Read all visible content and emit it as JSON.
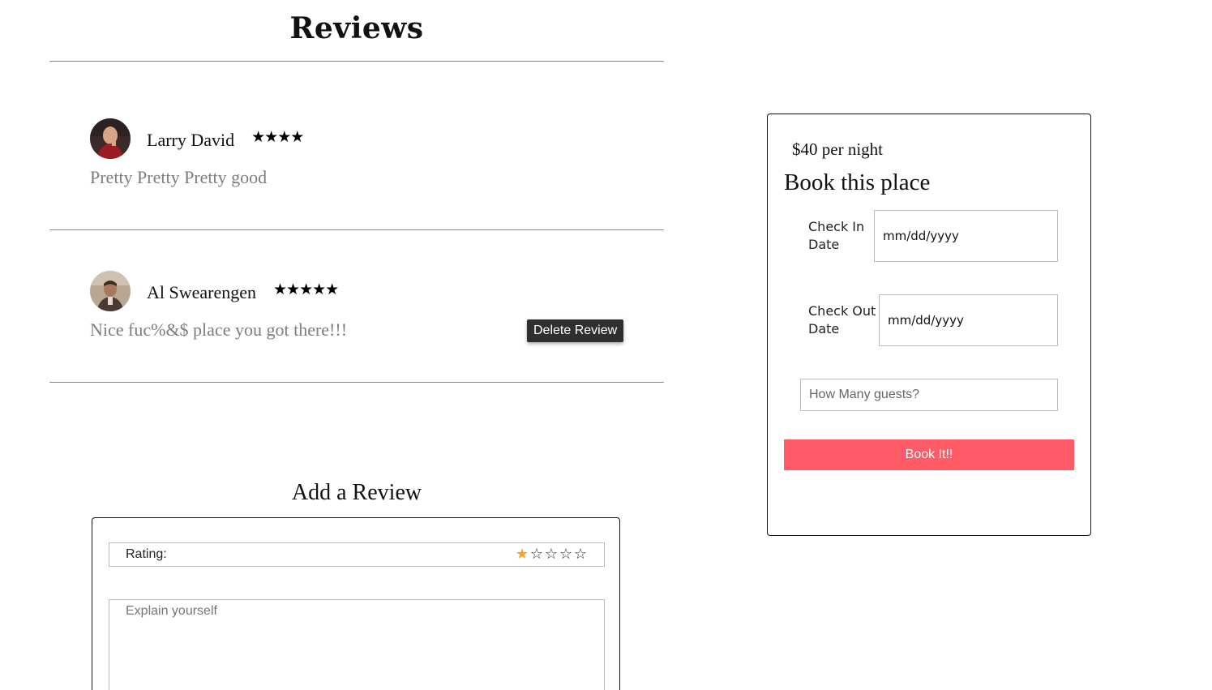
{
  "reviews_section": {
    "title": "Reviews",
    "reviews": [
      {
        "author": "Larry David",
        "rating": 4,
        "stars": "★★★★",
        "text": "Pretty Pretty Pretty good"
      },
      {
        "author": "Al Swearengen",
        "rating": 5,
        "stars": "★★★★★",
        "text": "Nice fuc%&$ place you got there!!!",
        "delete_label": "Delete Review"
      }
    ]
  },
  "add_review": {
    "title": "Add a Review",
    "rating_label": "Rating:",
    "rating_value": 1,
    "rating_max": 5,
    "star_filled": "★",
    "star_empty": "☆",
    "explain_placeholder": "Explain yourself"
  },
  "booking": {
    "price": "$40 per night",
    "title": "Book this place",
    "check_in_label": "Check In Date",
    "check_in_value": "mm/dd/yyyy",
    "check_out_label": "Check Out Date",
    "check_out_value": "mm/dd/yyyy",
    "guests_placeholder": "How Many guests?",
    "book_button": "Book It!!"
  },
  "colors": {
    "book_button": "#ff5a65",
    "star_selected": "#f5a623",
    "delete_button": "#2f2f2f",
    "review_text": "#7d7d7d"
  }
}
